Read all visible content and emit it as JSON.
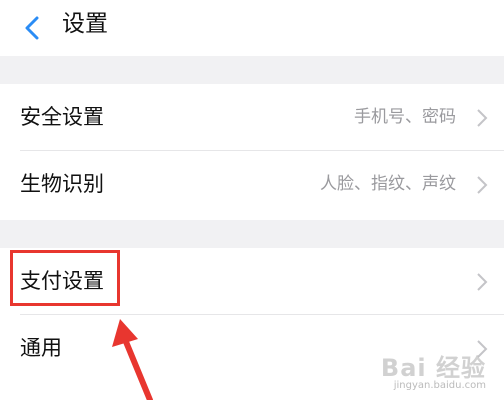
{
  "header": {
    "title": "设置",
    "back_icon": "chevron-left-icon"
  },
  "colors": {
    "accent": "#2a8cf5",
    "highlight": "#e8362f",
    "background": "#f1f1f3"
  },
  "sections": [
    {
      "rows": [
        {
          "label": "安全设置",
          "value": "手机号、密码"
        },
        {
          "label": "生物识别",
          "value": "人脸、指纹、声纹"
        }
      ]
    },
    {
      "rows": [
        {
          "label": "支付设置",
          "value": ""
        },
        {
          "label": "通用",
          "value": ""
        }
      ]
    }
  ],
  "watermark": {
    "logo": "Bai 经验",
    "url": "jingyan.baidu.com"
  }
}
